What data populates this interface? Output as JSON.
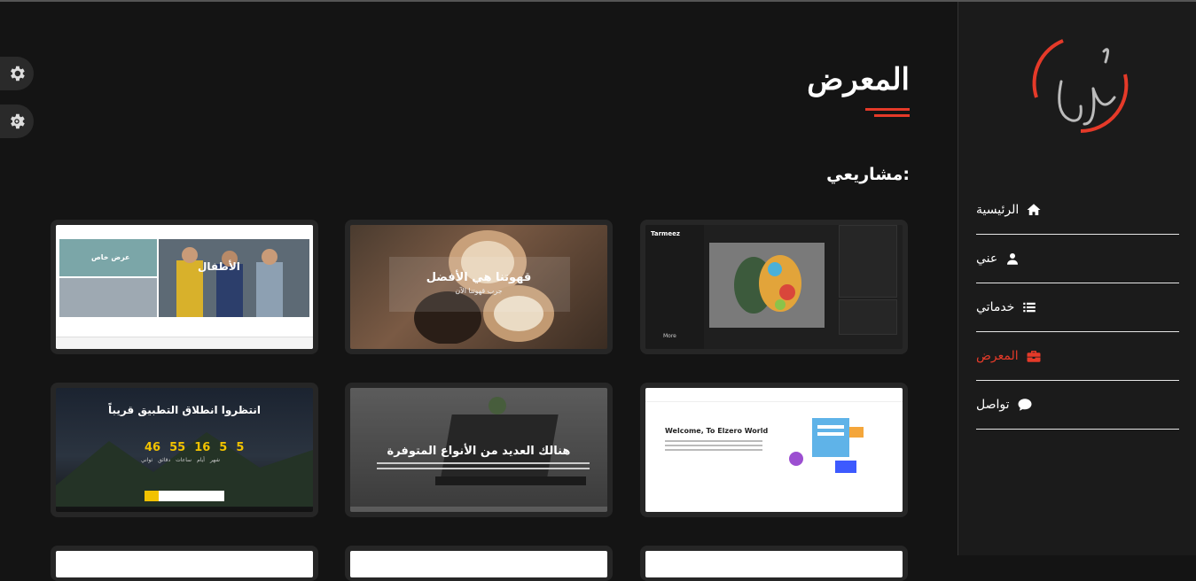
{
  "page": {
    "title": "المعرض",
    "section_label": "مشاريعي:"
  },
  "colors": {
    "accent": "#e53a29",
    "background": "#141414",
    "sidebar": "#1b1b1b",
    "card": "#262626"
  },
  "settings_buttons": [
    {
      "icon": "gear-icon"
    },
    {
      "icon": "sun-gear-icon"
    }
  ],
  "sidebar": {
    "logo_icon": "logo-signature",
    "items": [
      {
        "label": "الرئيسية",
        "icon": "home-icon",
        "active": false
      },
      {
        "label": "عني",
        "icon": "user-icon",
        "active": false
      },
      {
        "label": "خدماتي",
        "icon": "list-icon",
        "active": false
      },
      {
        "label": "المعرض",
        "icon": "briefcase-icon",
        "active": true
      },
      {
        "label": "تواصل",
        "icon": "chat-icon",
        "active": false
      }
    ]
  },
  "projects": [
    {
      "name": "tarmeez-social",
      "text": "Tarmeez",
      "subtext": "More"
    },
    {
      "name": "coffee-site",
      "text": "قهوتنا هي الأفضل",
      "subtext": "جرب قهوتنا الآن"
    },
    {
      "name": "kids-fashion-store",
      "text": "الأطفال",
      "subtext": "عرض خاص"
    },
    {
      "name": "elzero-world",
      "text": "Welcome, To Elzero World",
      "subtext": ""
    },
    {
      "name": "templates-site",
      "text": "هنالك العديد من الأنواع المتوفرة",
      "subtext": ""
    },
    {
      "name": "app-countdown",
      "text": "انتظروا انطلاق التطبيق قريباً",
      "subtext": "",
      "countdown": [
        "5",
        "5",
        "16",
        "55",
        "46"
      ],
      "countdown_labels": [
        "شهر",
        "أيام",
        "ساعات",
        "دقائق",
        "ثواني"
      ]
    }
  ]
}
